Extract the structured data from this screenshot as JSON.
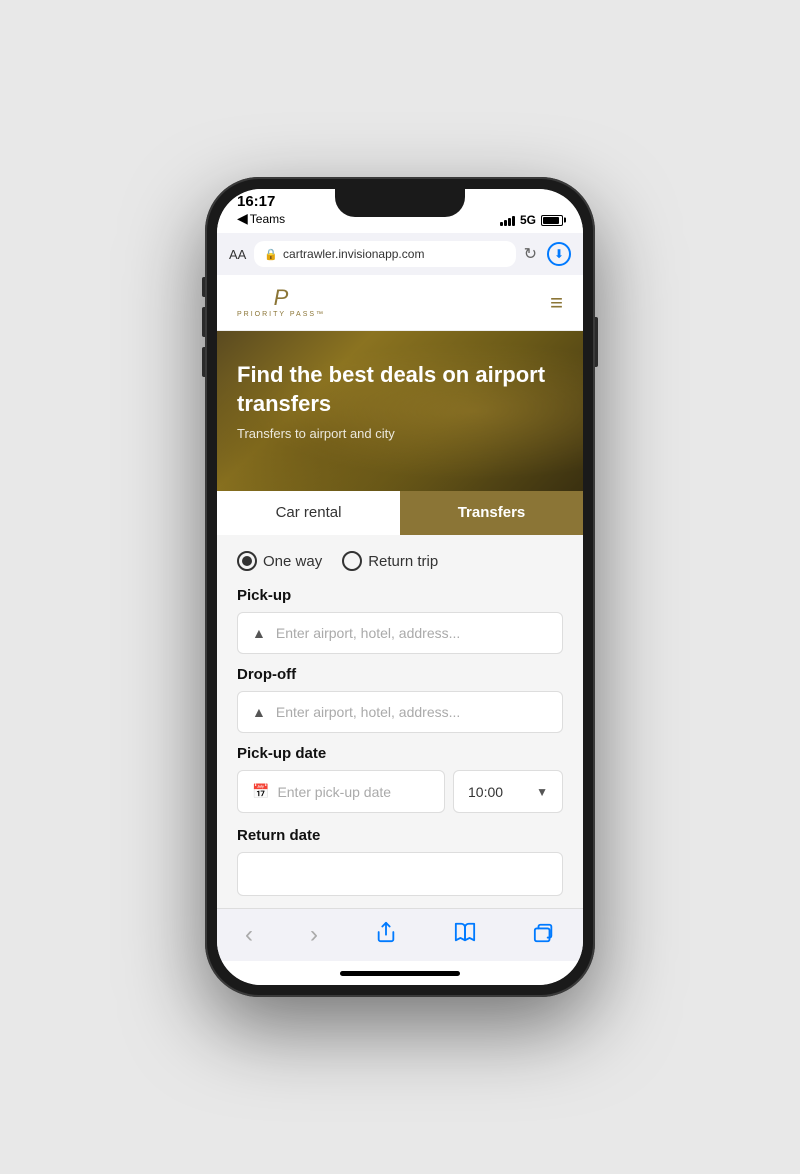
{
  "status_bar": {
    "time": "16:17",
    "back_label": "Teams",
    "signal_label": "5G"
  },
  "browser": {
    "aa_label": "AA",
    "url": "cartrawler.invisionapp.com",
    "lock_icon": "🔒"
  },
  "header": {
    "logo_p": "P",
    "logo_text": "PRIORITY PASS™",
    "hamburger_icon": "≡"
  },
  "hero": {
    "title": "Find the best deals on airport transfers",
    "subtitle": "Transfers to airport and city"
  },
  "tabs": [
    {
      "label": "Car rental",
      "active": false
    },
    {
      "label": "Transfers",
      "active": true
    }
  ],
  "form": {
    "trip_options": {
      "one_way": "One way",
      "return_trip": "Return trip"
    },
    "pickup_label": "Pick-up",
    "pickup_placeholder": "Enter airport, hotel, address...",
    "dropoff_label": "Drop-off",
    "dropoff_placeholder": "Enter airport, hotel, address...",
    "pickup_date_label": "Pick-up date",
    "pickup_date_placeholder": "Enter pick-up date",
    "pickup_time_value": "10:00",
    "return_date_label": "Return date"
  },
  "bottom_toolbar": {
    "back_label": "‹",
    "forward_label": "›",
    "share_label": "⬆",
    "bookmarks_label": "📖",
    "tabs_label": "⧉"
  }
}
